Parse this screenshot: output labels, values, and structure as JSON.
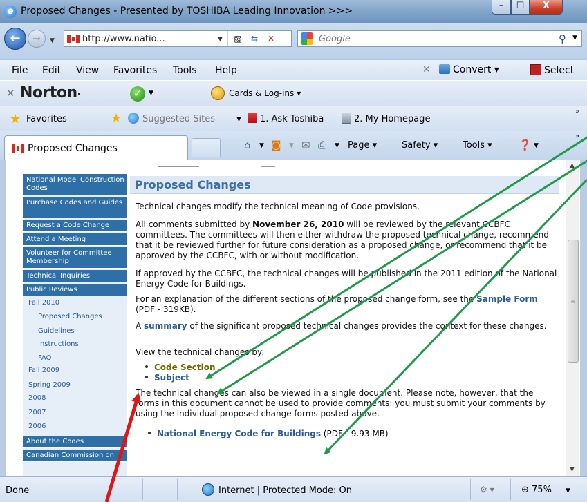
{
  "window": {
    "title": "Proposed Changes - Presented by TOSHIBA Leading Innovation >>>",
    "minimize": "–",
    "maximize": "☐",
    "close": "X"
  },
  "address_bar": {
    "url": "http://www.natio...",
    "search_placeholder": "Google"
  },
  "menu": {
    "items": [
      {
        "label": "File"
      },
      {
        "label": "Edit"
      },
      {
        "label": "View"
      },
      {
        "label": "Favorites"
      },
      {
        "label": "Tools"
      },
      {
        "label": "Help"
      }
    ],
    "convert": "Convert",
    "select": "Select"
  },
  "norton_bar": {
    "brand": "Norton",
    "cards": "Cards & Log-ins"
  },
  "favorites_bar": {
    "favorites": "Favorites",
    "suggested": "Suggested Sites",
    "ask_toshiba": "1. Ask Toshiba",
    "my_homepage": "2. My Homepage"
  },
  "tabs": {
    "active": "Proposed Changes",
    "commands": {
      "page": "Page",
      "safety": "Safety",
      "tools": "Tools"
    }
  },
  "sidenav": {
    "items": [
      {
        "label": "National Model Construction Codes",
        "style": "dark"
      },
      {
        "label": "Purchase Codes and Guides",
        "style": "dark"
      },
      {
        "label": "Request a Code Change",
        "style": "dark"
      },
      {
        "label": "Attend a Meeting",
        "style": "dark"
      },
      {
        "label": "Volunteer for Committee Membership",
        "style": "dark"
      },
      {
        "label": "Technical Inquiries",
        "style": "dark"
      },
      {
        "label": "Public Reviews",
        "style": "dark"
      },
      {
        "label": "Fall 2010",
        "style": "sub"
      },
      {
        "label": "Proposed Changes",
        "style": "subsub"
      },
      {
        "label": "Guidelines",
        "style": "subsub"
      },
      {
        "label": "Instructions",
        "style": "subsub"
      },
      {
        "label": "FAQ",
        "style": "subsub"
      },
      {
        "label": "Fall 2009",
        "style": "sub"
      },
      {
        "label": "Spring 2009",
        "style": "sub"
      },
      {
        "label": "2008",
        "style": "sub"
      },
      {
        "label": "2007",
        "style": "sub"
      },
      {
        "label": "2006",
        "style": "sub"
      },
      {
        "label": "About the Codes",
        "style": "dark"
      },
      {
        "label": "Canadian Commission on",
        "style": "dark"
      }
    ]
  },
  "page": {
    "heading": "Proposed Changes",
    "intro": "Technical changes modify the technical meaning of Code provisions.",
    "p2_before": "All comments submitted by ",
    "p2_bold": "November 26, 2010",
    "p2_after": " will be reviewed by the relevant CCBFC committees. The committees will then either withdraw the proposed technical change, recommend that it be reviewed further for future consideration as a proposed change, or recommend that it be approved by the CCBFC, with or without modification.",
    "p3": "If approved by the CCBFC, the technical changes will be published in the 2011 edition of the National Energy Code for Buildings.",
    "p4_before": "For an explanation of the different sections of the proposed change form, see the ",
    "p4_link": "Sample Form",
    "p4_after": " (PDF - 319KB).",
    "p5_before": "A ",
    "p5_link": "summary",
    "p5_after": " of the significant proposed technical changes provides the context for these changes.",
    "view_by": "View the technical changes by:",
    "view_links": [
      "Code Section",
      "Subject"
    ],
    "p6": "The technical changes can also be viewed in a single document. Please note, however, that the forms in this document cannot be used to provide comments: you must submit your comments by using the individual proposed change forms posted above.",
    "doc_link": "National Energy Code for Buildings",
    "doc_size": " (PDF - 9.93 MB)"
  },
  "status": {
    "left": "Done",
    "zone": "Internet | Protected Mode: On",
    "zoom": "75%"
  },
  "colors": {
    "nav_dark": "#2e6fa8",
    "heading_text": "#3d6ea4",
    "link": "#2a5a99",
    "annotation_green": "#1f9a4a",
    "annotation_red": "#e01515"
  }
}
